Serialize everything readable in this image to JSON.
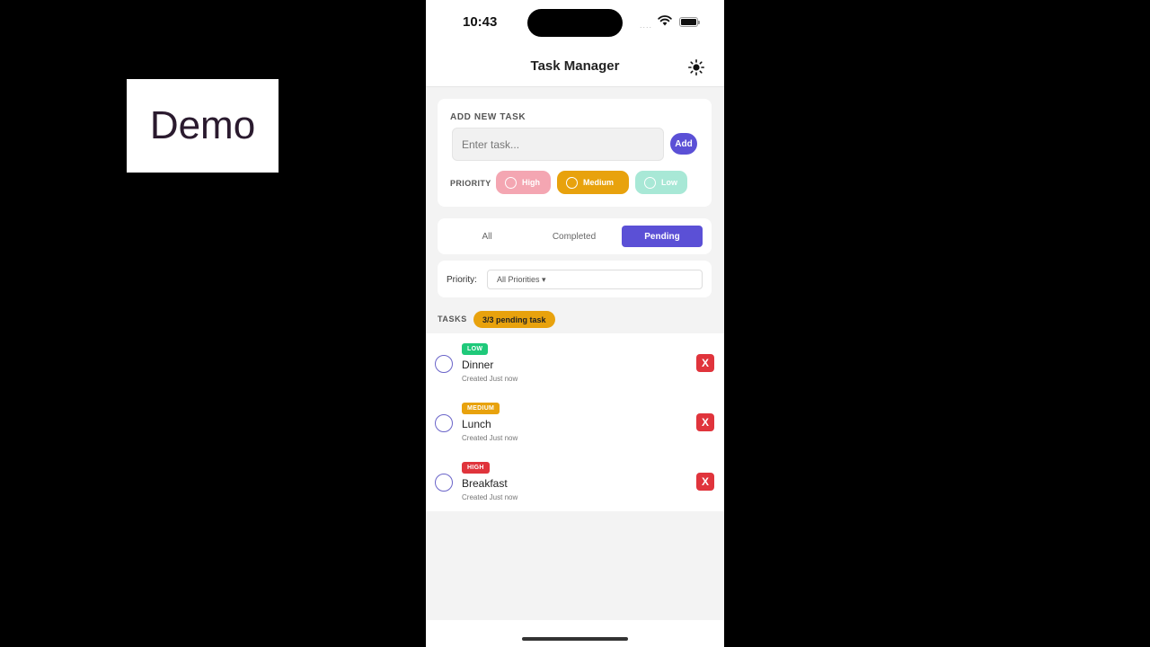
{
  "overlay": {
    "demo_label": "Demo"
  },
  "status_bar": {
    "time": "10:43",
    "signal": "....",
    "icons": [
      "wifi-icon",
      "battery-icon"
    ]
  },
  "header": {
    "title": "Task Manager",
    "theme_icon": "sun-icon"
  },
  "add_task": {
    "section_label": "ADD NEW TASK",
    "input_placeholder": "Enter task...",
    "input_value": "",
    "add_button": "Add",
    "priority_label": "PRIORITY",
    "priorities": [
      {
        "label": "High",
        "color": "#f4a6b2",
        "selected": false
      },
      {
        "label": "Medium",
        "color": "#e8a20d",
        "selected": true
      },
      {
        "label": "Low",
        "color": "#a8e8d6",
        "selected": false
      }
    ]
  },
  "filter_tabs": {
    "items": [
      {
        "label": "All",
        "active": false
      },
      {
        "label": "Completed",
        "active": false
      },
      {
        "label": "Pending",
        "active": true
      }
    ],
    "accent": "#5b50d6"
  },
  "priority_filter": {
    "label": "Priority:",
    "selected": "All Priorities ▾"
  },
  "tasks": {
    "section_label": "TASKS",
    "count_badge": "3/3 pending task",
    "items": [
      {
        "priority": "LOW",
        "priority_color": "#1fc97a",
        "title": "Dinner",
        "meta": "Created Just now",
        "delete_label": "X"
      },
      {
        "priority": "MEDIUM",
        "priority_color": "#e8a20d",
        "title": "Lunch",
        "meta": "Created Just now",
        "delete_label": "X"
      },
      {
        "priority": "HIGH",
        "priority_color": "#e0343c",
        "title": "Breakfast",
        "meta": "Created Just now",
        "delete_label": "X"
      }
    ]
  }
}
